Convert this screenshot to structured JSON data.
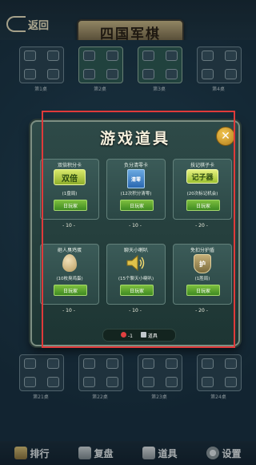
{
  "header": {
    "back_label": "返回",
    "logo_text": "四国军棋"
  },
  "tables_top": [
    {
      "label": "第1桌",
      "lit": false
    },
    {
      "label": "第2桌",
      "lit": true
    },
    {
      "label": "第3桌",
      "lit": true
    },
    {
      "label": "第4桌",
      "lit": false
    }
  ],
  "tables_bottom": [
    {
      "label": "第21桌"
    },
    {
      "label": "第22桌"
    },
    {
      "label": "第23桌"
    },
    {
      "label": "第24桌"
    }
  ],
  "nav": {
    "rank": "排行",
    "replay": "复盘",
    "items": "道具",
    "settings": "设置"
  },
  "modal": {
    "title": "游戏道具",
    "close_symbol": "✕",
    "items": [
      {
        "name": "双倍积分卡",
        "art_text": "双倍",
        "desc": "(1盘局)",
        "buy": "日玩家",
        "price": "- 10 -"
      },
      {
        "name": "负分清零卡",
        "art_text": "清零",
        "desc": "(12次积分清零)",
        "buy": "日玩家",
        "price": "- 10 -"
      },
      {
        "name": "技记棋子卡",
        "art_text": "记子器",
        "desc": "(20次标记机会)",
        "buy": "日玩家",
        "price": "- 20 -"
      },
      {
        "name": "砸人臭鸡蛋",
        "art_text": "",
        "desc": "(10枚臭鸡蛋)",
        "buy": "日玩家",
        "price": "- 10 -"
      },
      {
        "name": "聊天小喇叭",
        "art_text": "",
        "desc": "(15个聊天小喇叭)",
        "buy": "日玩家",
        "price": "- 10 -"
      },
      {
        "name": "免扣分护盾",
        "art_text": "护",
        "desc": "(1胜局)",
        "buy": "日玩家",
        "price": "- 20 -"
      }
    ],
    "status": {
      "coins": "-1",
      "items": "道具"
    }
  },
  "colors": {
    "highlight": "#e03a3a",
    "buy_button": "#5aa82e",
    "close_button": "#e0a83a"
  }
}
